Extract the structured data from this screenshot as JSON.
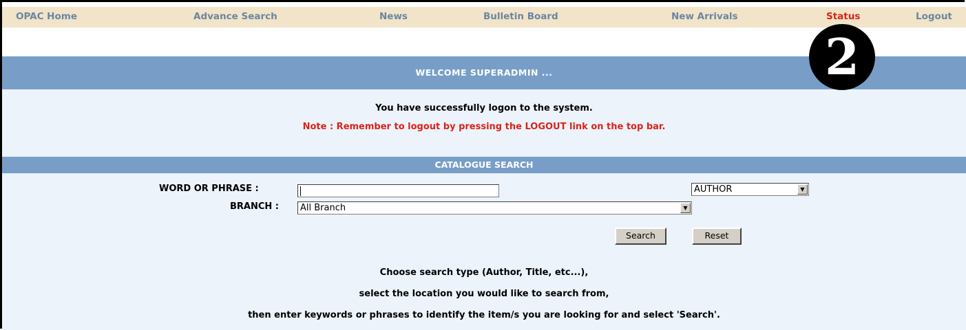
{
  "nav": {
    "items": [
      "OPAC Home",
      "Advance Search",
      "News",
      "Bulletin Board",
      "New Arrivals",
      "Status",
      "Logout"
    ],
    "active": "Status"
  },
  "badge": "2",
  "welcome": {
    "title": "WELCOME SUPERADMIN ...",
    "message": "You have successfully logon to the system.",
    "note": "Note : Remember to logout by pressing the LOGOUT link on the top bar."
  },
  "search": {
    "title": "CATALOGUE SEARCH",
    "word_label": "WORD OR PHRASE :",
    "word_value": "",
    "type_selected": "AUTHOR",
    "branch_label": "BRANCH :",
    "branch_selected": "All Branch",
    "search_button": "Search",
    "reset_button": "Reset",
    "help": [
      "Choose search type (Author, Title, etc...),",
      "select the location you would like to search from,",
      "then enter keywords or phrases to identify the item/s you are looking for and select 'Search'."
    ]
  },
  "colors": {
    "nav_bg": "#f1e4c8",
    "nav_link": "#6b86a3",
    "active_link": "#d9241a",
    "header_band": "#789ec8",
    "panel_bg": "#ecf3fb"
  }
}
